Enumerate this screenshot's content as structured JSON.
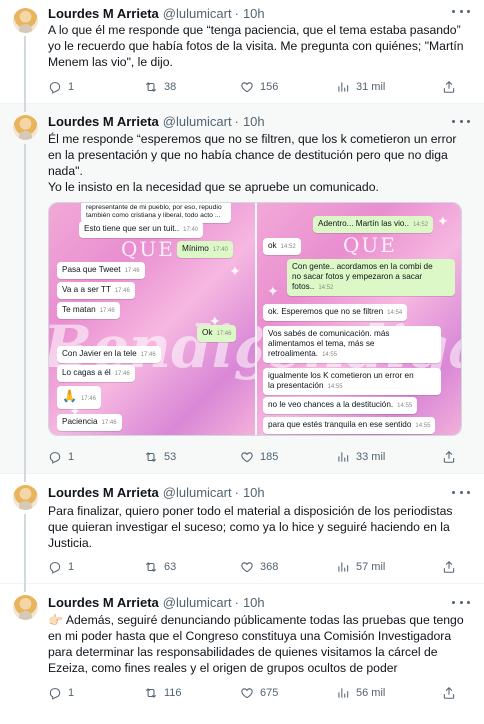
{
  "author": {
    "name": "Lourdes M Arrieta",
    "handle": "@lulumicart",
    "sep": "·",
    "time": "10h"
  },
  "tweets": [
    {
      "text": "A lo que él me responde que “tenga paciencia, que el tema estaba pasando” yo le recuerdo que había fotos de la visita. Me pregunta con quiénes; \"Martín Menem las vio\", le dijo.",
      "replies": "1",
      "retweets": "38",
      "likes": "156",
      "views": "31 mil"
    },
    {
      "text": "Él me responde “esperemos que no se filtren, que los k cometieron un error en la presentación y que no había chance de destitución pero que no diga nada\".\nYo le insisto en la necesidad que se apruebe un comunicado.",
      "replies": "1",
      "retweets": "53",
      "likes": "185",
      "views": "33 mil"
    },
    {
      "text": "Para finalizar, quiero poner todo el material a disposición de los periodistas que quieran investigar el suceso; como ya lo hice y seguiré haciendo en la Justicia.",
      "replies": "1",
      "retweets": "63",
      "likes": "368",
      "views": "57 mil"
    },
    {
      "text": "👉🏻 Además, seguiré denunciando públicamente todas las pruebas que tengo en mi poder hasta que el Congreso constituya una Comisión Investigadora para determinar las responsabilidades de quienes visitamos la cárcel de Ezeiza, como fines reales y el origen de grupos ocultos de poder",
      "replies": "1",
      "retweets": "116",
      "likes": "675",
      "views": "56 mil"
    }
  ],
  "media": {
    "left": {
      "bg_word": "Bendiga",
      "que": "QUE",
      "messages": [
        {
          "text": "representante de mi pueblo, por eso, repudio\ntambién como cristiana y liberal, todo acto ...",
          "time": ""
        },
        {
          "text": "Esto tiene que ser un tuit..",
          "time": "17:40"
        },
        {
          "text": "Mínimo",
          "time": "17:40"
        },
        {
          "text": "Pasa que Tweet",
          "time": "17:46"
        },
        {
          "text": "Va a a ser TT",
          "time": "17:46"
        },
        {
          "text": "Te matan",
          "time": "17:46"
        },
        {
          "text": "Ok",
          "time": "17:46"
        },
        {
          "text": "Con Javier en la tele",
          "time": "17:46"
        },
        {
          "text": "Lo cagas a él",
          "time": "17:46"
        },
        {
          "text": "🙏",
          "time": "17:46"
        },
        {
          "text": "Paciencia",
          "time": "17:46"
        }
      ]
    },
    "right": {
      "que": "QUE",
      "messages": [
        {
          "text": "Adentro... Martín las vio..",
          "time": "14:52"
        },
        {
          "text": "ok",
          "time": "14:52"
        },
        {
          "text": "Con gente.. acordamos en la combi de\nno sacar fotos y empezaron a sacar\nfotos..",
          "time": "14:52"
        },
        {
          "text": "ok. Esperemos que no se filtren",
          "time": "14:54"
        },
        {
          "text": "Vos sabés de comunicación. más\nalimentamos el tema, más se\nretroalimenta.",
          "time": "14:55"
        },
        {
          "text": "igualmente los K cometieron un error en\nla presentación",
          "time": "14:55"
        },
        {
          "text": "no le veo chances a la destitución.",
          "time": "14:55"
        },
        {
          "text": "para que estés tranquila en ese sentido",
          "time": "14:55"
        }
      ]
    }
  },
  "icons": {
    "reply": "reply-icon",
    "retweet": "retweet-icon",
    "like": "heart-icon",
    "views": "views-icon",
    "share": "share-icon",
    "more": "more-icon"
  }
}
